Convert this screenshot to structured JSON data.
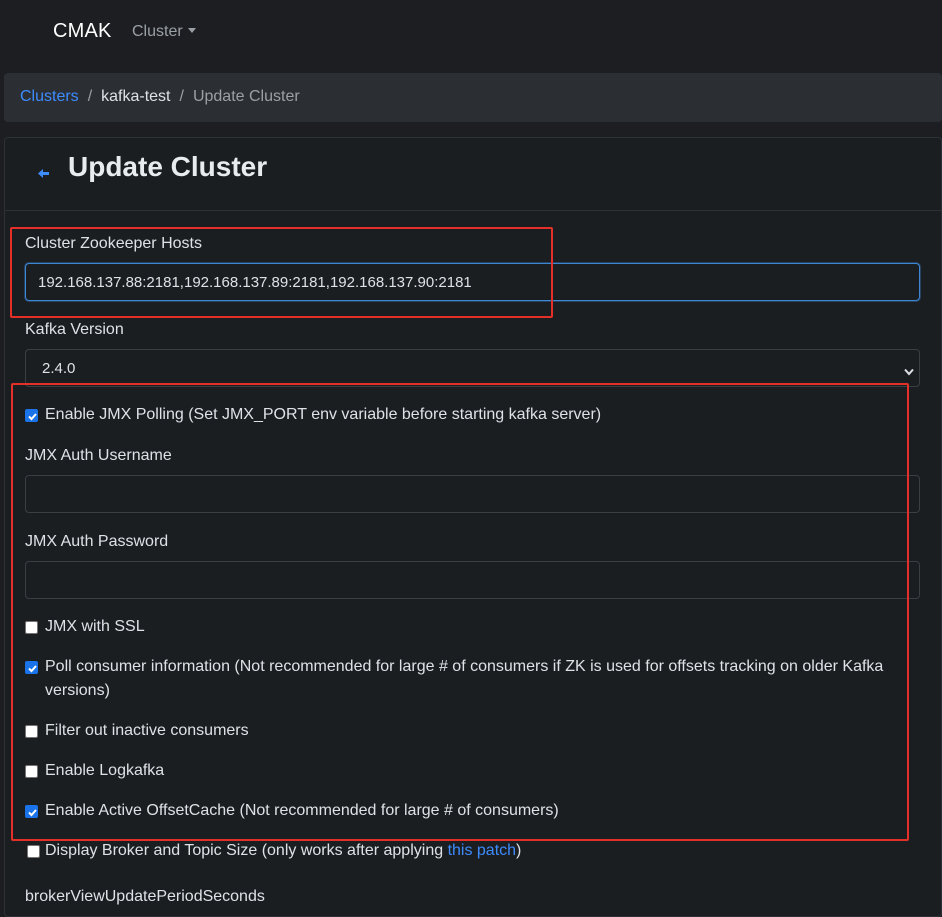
{
  "nav": {
    "brand": "CMAK",
    "cluster_menu": "Cluster"
  },
  "breadcrumb": {
    "clusters": "Clusters",
    "cluster_name": "kafka-test",
    "current": "Update Cluster",
    "separator": "/"
  },
  "header": {
    "title": "Update Cluster"
  },
  "form": {
    "zk_hosts_label": "Cluster Zookeeper Hosts",
    "zk_hosts_value": "192.168.137.88:2181,192.168.137.89:2181,192.168.137.90:2181",
    "kafka_version_label": "Kafka Version",
    "kafka_version_value": "2.4.0",
    "jmx_polling_label": "Enable JMX Polling (Set JMX_PORT env variable before starting kafka server)",
    "jmx_username_label": "JMX Auth Username",
    "jmx_username_value": "",
    "jmx_password_label": "JMX Auth Password",
    "jmx_password_value": "",
    "jmx_ssl_label": "JMX with SSL",
    "poll_consumer_label": "Poll consumer information (Not recommended for large # of consumers if ZK is used for offsets tracking on older Kafka versions)",
    "filter_inactive_label": "Filter out inactive consumers",
    "logkafka_label": "Enable Logkafka",
    "offset_cache_label": "Enable Active OffsetCache (Not recommended for large # of consumers)",
    "broker_topic_size_label": "Display Broker and Topic Size (only works after applying ",
    "broker_topic_size_link": "this patch",
    "broker_topic_size_suffix": ")",
    "broker_view_label": "brokerViewUpdatePeriodSeconds"
  },
  "checkbox_states": {
    "jmx_polling": true,
    "jmx_ssl": false,
    "poll_consumer": true,
    "filter_inactive": false,
    "logkafka": false,
    "offset_cache": true,
    "broker_topic_size": false
  },
  "icons": {
    "back": "arrow-left-icon",
    "select_chevron": "chevron-down-icon",
    "caret": "caret-down-icon",
    "check": "check-icon"
  },
  "colors": {
    "background": "#1c1e22",
    "link": "#3d8bfd",
    "checkbox_checked": "#1a73e8",
    "highlight_box": "#e5302a",
    "focus_border": "#3c86d4"
  }
}
